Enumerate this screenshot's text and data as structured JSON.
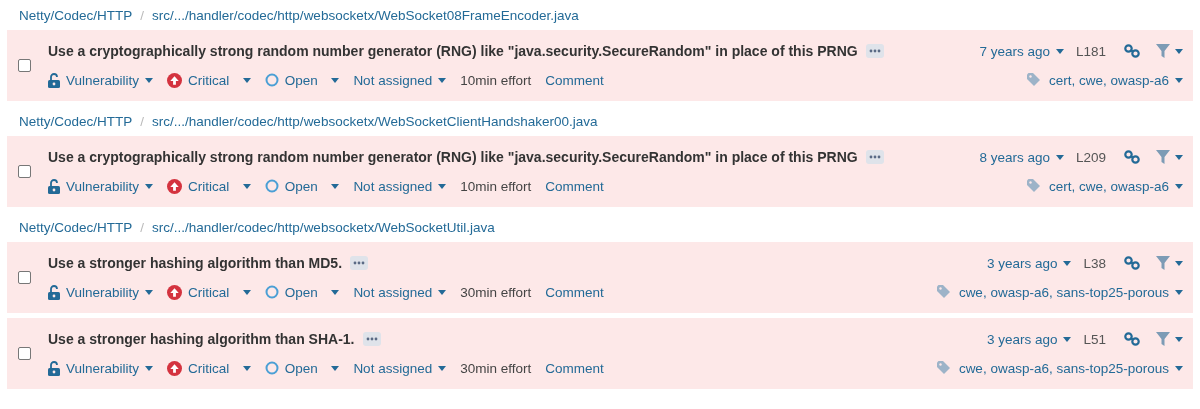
{
  "groups": [
    {
      "component": "Netty/Codec/HTTP",
      "separator": "/",
      "path": "src/.../handler/codec/http/websocketx/WebSocket08FrameEncoder.java",
      "issues": [
        {
          "checked": false,
          "title": "Use a cryptographically strong random number generator (RNG) like \"java.security.SecureRandom\" in place of this PRNG",
          "type": "Vulnerability",
          "severity": "Critical",
          "status": "Open",
          "assignee": "Not assigned",
          "effort": "10min effort",
          "comment": "Comment",
          "age": "7 years ago",
          "line": "L181",
          "tags": "cert, cwe, owasp-a6"
        }
      ]
    },
    {
      "component": "Netty/Codec/HTTP",
      "separator": "/",
      "path": "src/.../handler/codec/http/websocketx/WebSocketClientHandshaker00.java",
      "issues": [
        {
          "checked": false,
          "title": "Use a cryptographically strong random number generator (RNG) like \"java.security.SecureRandom\" in place of this PRNG",
          "type": "Vulnerability",
          "severity": "Critical",
          "status": "Open",
          "assignee": "Not assigned",
          "effort": "10min effort",
          "comment": "Comment",
          "age": "8 years ago",
          "line": "L209",
          "tags": "cert, cwe, owasp-a6"
        }
      ]
    },
    {
      "component": "Netty/Codec/HTTP",
      "separator": "/",
      "path": "src/.../handler/codec/http/websocketx/WebSocketUtil.java",
      "issues": [
        {
          "checked": false,
          "title": "Use a stronger hashing algorithm than MD5.",
          "type": "Vulnerability",
          "severity": "Critical",
          "status": "Open",
          "assignee": "Not assigned",
          "effort": "30min effort",
          "comment": "Comment",
          "age": "3 years ago",
          "line": "L38",
          "tags": "cwe, owasp-a6, sans-top25-porous"
        },
        {
          "checked": false,
          "title": "Use a stronger hashing algorithm than SHA-1.",
          "type": "Vulnerability",
          "severity": "Critical",
          "status": "Open",
          "assignee": "Not assigned",
          "effort": "30min effort",
          "comment": "Comment",
          "age": "3 years ago",
          "line": "L51",
          "tags": "cwe, owasp-a6, sans-top25-porous"
        }
      ]
    }
  ]
}
